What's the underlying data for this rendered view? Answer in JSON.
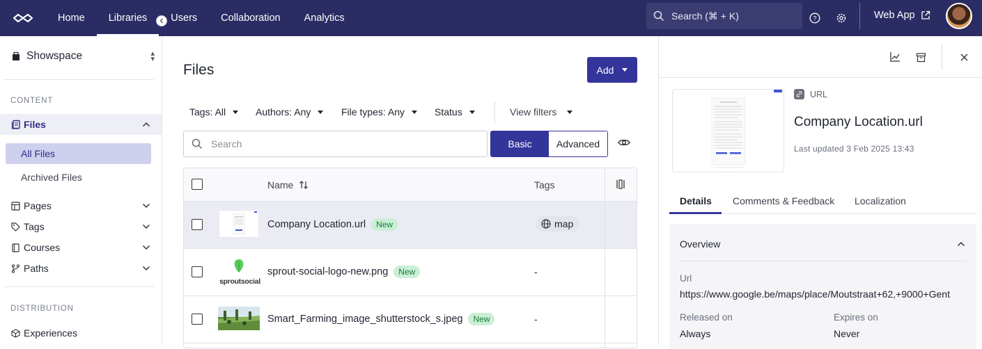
{
  "topnav": {
    "items": [
      "Home",
      "Libraries",
      "Users",
      "Collaboration",
      "Analytics"
    ],
    "active": "Libraries",
    "search_placeholder": "Search (⌘ + K)",
    "web_app": "Web App"
  },
  "sidebar": {
    "workspace": "Showspace",
    "content_label": "CONTENT",
    "files_label": "Files",
    "sub_items": [
      "All Files",
      "Archived Files"
    ],
    "items": [
      "Pages",
      "Tags",
      "Courses",
      "Paths"
    ],
    "distribution_label": "DISTRIBUTION",
    "experiences": "Experiences"
  },
  "main": {
    "title": "Files",
    "add_label": "Add",
    "filters": [
      "Tags: All",
      "Authors: Any",
      "File types: Any",
      "Status",
      "View filters"
    ],
    "search_placeholder": "Search",
    "seg_basic": "Basic",
    "seg_advanced": "Advanced",
    "table": {
      "col_name": "Name",
      "col_tags": "Tags",
      "rows": [
        {
          "name": "Company Location.url",
          "badge": "New",
          "tag": "map"
        },
        {
          "name": "sprout-social-logo-new.png",
          "badge": "New",
          "tag": "-"
        },
        {
          "name": "Smart_Farming_image_shutterstock_s.jpeg",
          "badge": "New",
          "tag": "-"
        }
      ],
      "sprout_text": "sproutsocial"
    }
  },
  "panel": {
    "type_label": "URL",
    "file_title": "Company Location.url",
    "last_updated": "Last updated 3 Feb 2025 13:43",
    "tabs": [
      "Details",
      "Comments & Feedback",
      "Localization"
    ],
    "overview": {
      "title": "Overview",
      "url_label": "Url",
      "url_value": "https://www.google.be/maps/place/Moutstraat+62,+9000+Gent",
      "released_label": "Released on",
      "released_value": "Always",
      "expires_label": "Expires on",
      "expires_value": "Never"
    }
  },
  "colors": {
    "topbar": "#2b2c63",
    "accent": "#34359b",
    "badge_bg": "#c9efd4"
  }
}
